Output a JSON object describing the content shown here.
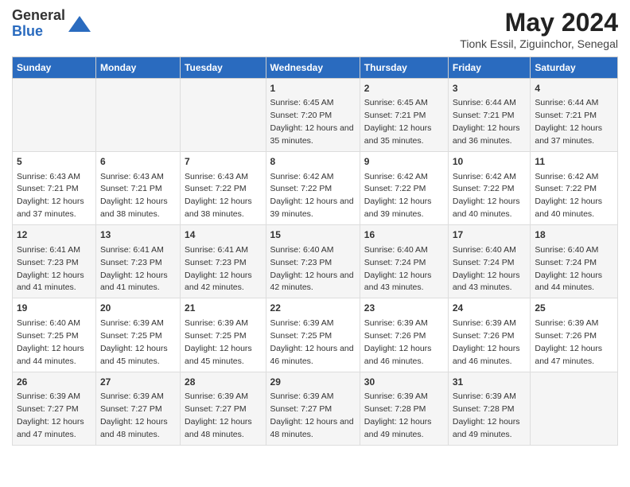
{
  "header": {
    "logo_general": "General",
    "logo_blue": "Blue",
    "main_title": "May 2024",
    "subtitle": "Tionk Essil, Ziguinchor, Senegal"
  },
  "days_of_week": [
    "Sunday",
    "Monday",
    "Tuesday",
    "Wednesday",
    "Thursday",
    "Friday",
    "Saturday"
  ],
  "weeks": [
    [
      {
        "day": "",
        "sunrise": "",
        "sunset": "",
        "daylight": "",
        "empty": true
      },
      {
        "day": "",
        "sunrise": "",
        "sunset": "",
        "daylight": "",
        "empty": true
      },
      {
        "day": "",
        "sunrise": "",
        "sunset": "",
        "daylight": "",
        "empty": true
      },
      {
        "day": "1",
        "sunrise": "Sunrise: 6:45 AM",
        "sunset": "Sunset: 7:20 PM",
        "daylight": "Daylight: 12 hours and 35 minutes."
      },
      {
        "day": "2",
        "sunrise": "Sunrise: 6:45 AM",
        "sunset": "Sunset: 7:21 PM",
        "daylight": "Daylight: 12 hours and 35 minutes."
      },
      {
        "day": "3",
        "sunrise": "Sunrise: 6:44 AM",
        "sunset": "Sunset: 7:21 PM",
        "daylight": "Daylight: 12 hours and 36 minutes."
      },
      {
        "day": "4",
        "sunrise": "Sunrise: 6:44 AM",
        "sunset": "Sunset: 7:21 PM",
        "daylight": "Daylight: 12 hours and 37 minutes."
      }
    ],
    [
      {
        "day": "5",
        "sunrise": "Sunrise: 6:43 AM",
        "sunset": "Sunset: 7:21 PM",
        "daylight": "Daylight: 12 hours and 37 minutes."
      },
      {
        "day": "6",
        "sunrise": "Sunrise: 6:43 AM",
        "sunset": "Sunset: 7:21 PM",
        "daylight": "Daylight: 12 hours and 38 minutes."
      },
      {
        "day": "7",
        "sunrise": "Sunrise: 6:43 AM",
        "sunset": "Sunset: 7:22 PM",
        "daylight": "Daylight: 12 hours and 38 minutes."
      },
      {
        "day": "8",
        "sunrise": "Sunrise: 6:42 AM",
        "sunset": "Sunset: 7:22 PM",
        "daylight": "Daylight: 12 hours and 39 minutes."
      },
      {
        "day": "9",
        "sunrise": "Sunrise: 6:42 AM",
        "sunset": "Sunset: 7:22 PM",
        "daylight": "Daylight: 12 hours and 39 minutes."
      },
      {
        "day": "10",
        "sunrise": "Sunrise: 6:42 AM",
        "sunset": "Sunset: 7:22 PM",
        "daylight": "Daylight: 12 hours and 40 minutes."
      },
      {
        "day": "11",
        "sunrise": "Sunrise: 6:42 AM",
        "sunset": "Sunset: 7:22 PM",
        "daylight": "Daylight: 12 hours and 40 minutes."
      }
    ],
    [
      {
        "day": "12",
        "sunrise": "Sunrise: 6:41 AM",
        "sunset": "Sunset: 7:23 PM",
        "daylight": "Daylight: 12 hours and 41 minutes."
      },
      {
        "day": "13",
        "sunrise": "Sunrise: 6:41 AM",
        "sunset": "Sunset: 7:23 PM",
        "daylight": "Daylight: 12 hours and 41 minutes."
      },
      {
        "day": "14",
        "sunrise": "Sunrise: 6:41 AM",
        "sunset": "Sunset: 7:23 PM",
        "daylight": "Daylight: 12 hours and 42 minutes."
      },
      {
        "day": "15",
        "sunrise": "Sunrise: 6:40 AM",
        "sunset": "Sunset: 7:23 PM",
        "daylight": "Daylight: 12 hours and 42 minutes."
      },
      {
        "day": "16",
        "sunrise": "Sunrise: 6:40 AM",
        "sunset": "Sunset: 7:24 PM",
        "daylight": "Daylight: 12 hours and 43 minutes."
      },
      {
        "day": "17",
        "sunrise": "Sunrise: 6:40 AM",
        "sunset": "Sunset: 7:24 PM",
        "daylight": "Daylight: 12 hours and 43 minutes."
      },
      {
        "day": "18",
        "sunrise": "Sunrise: 6:40 AM",
        "sunset": "Sunset: 7:24 PM",
        "daylight": "Daylight: 12 hours and 44 minutes."
      }
    ],
    [
      {
        "day": "19",
        "sunrise": "Sunrise: 6:40 AM",
        "sunset": "Sunset: 7:25 PM",
        "daylight": "Daylight: 12 hours and 44 minutes."
      },
      {
        "day": "20",
        "sunrise": "Sunrise: 6:39 AM",
        "sunset": "Sunset: 7:25 PM",
        "daylight": "Daylight: 12 hours and 45 minutes."
      },
      {
        "day": "21",
        "sunrise": "Sunrise: 6:39 AM",
        "sunset": "Sunset: 7:25 PM",
        "daylight": "Daylight: 12 hours and 45 minutes."
      },
      {
        "day": "22",
        "sunrise": "Sunrise: 6:39 AM",
        "sunset": "Sunset: 7:25 PM",
        "daylight": "Daylight: 12 hours and 46 minutes."
      },
      {
        "day": "23",
        "sunrise": "Sunrise: 6:39 AM",
        "sunset": "Sunset: 7:26 PM",
        "daylight": "Daylight: 12 hours and 46 minutes."
      },
      {
        "day": "24",
        "sunrise": "Sunrise: 6:39 AM",
        "sunset": "Sunset: 7:26 PM",
        "daylight": "Daylight: 12 hours and 46 minutes."
      },
      {
        "day": "25",
        "sunrise": "Sunrise: 6:39 AM",
        "sunset": "Sunset: 7:26 PM",
        "daylight": "Daylight: 12 hours and 47 minutes."
      }
    ],
    [
      {
        "day": "26",
        "sunrise": "Sunrise: 6:39 AM",
        "sunset": "Sunset: 7:27 PM",
        "daylight": "Daylight: 12 hours and 47 minutes."
      },
      {
        "day": "27",
        "sunrise": "Sunrise: 6:39 AM",
        "sunset": "Sunset: 7:27 PM",
        "daylight": "Daylight: 12 hours and 48 minutes."
      },
      {
        "day": "28",
        "sunrise": "Sunrise: 6:39 AM",
        "sunset": "Sunset: 7:27 PM",
        "daylight": "Daylight: 12 hours and 48 minutes."
      },
      {
        "day": "29",
        "sunrise": "Sunrise: 6:39 AM",
        "sunset": "Sunset: 7:27 PM",
        "daylight": "Daylight: 12 hours and 48 minutes."
      },
      {
        "day": "30",
        "sunrise": "Sunrise: 6:39 AM",
        "sunset": "Sunset: 7:28 PM",
        "daylight": "Daylight: 12 hours and 49 minutes."
      },
      {
        "day": "31",
        "sunrise": "Sunrise: 6:39 AM",
        "sunset": "Sunset: 7:28 PM",
        "daylight": "Daylight: 12 hours and 49 minutes."
      },
      {
        "day": "",
        "sunrise": "",
        "sunset": "",
        "daylight": "",
        "empty": true
      }
    ]
  ]
}
